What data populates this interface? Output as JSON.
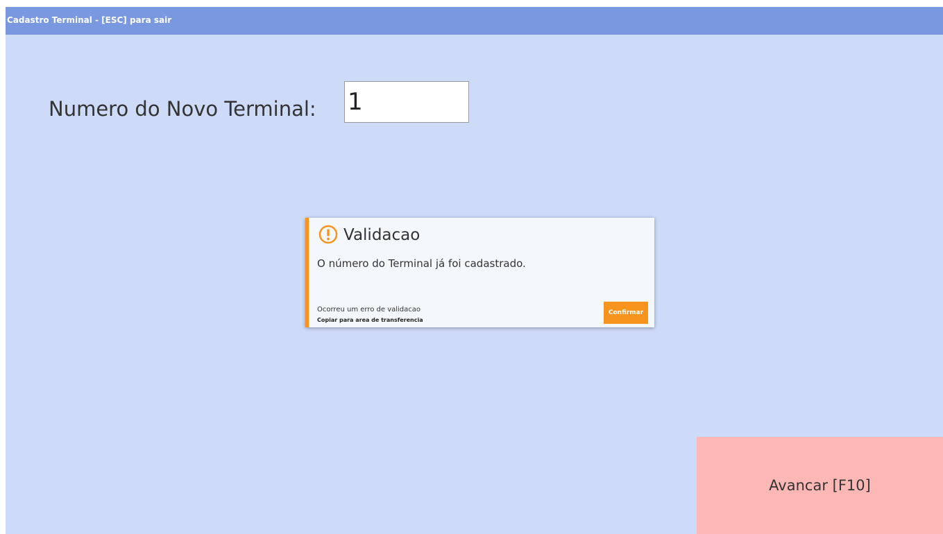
{
  "window": {
    "title": "Cadastro Terminal - [ESC] para sair"
  },
  "form": {
    "terminal_label": "Numero do Novo Terminal:",
    "terminal_value": "1"
  },
  "dialog": {
    "icon": "exclamation-circle-icon",
    "title": "Validacao",
    "message": "O número do Terminal já foi cadastrado.",
    "detail": "Ocorreu um erro de validacao",
    "copy_link": "Copiar para area de transferencia",
    "confirm_label": "Confirmar"
  },
  "actions": {
    "advance_label": "Avancar [F10]"
  },
  "colors": {
    "background": "#cddaf8",
    "titlebar": "#7a98df",
    "accent_orange": "#f7941d",
    "advance_button": "#fdb8b6"
  }
}
